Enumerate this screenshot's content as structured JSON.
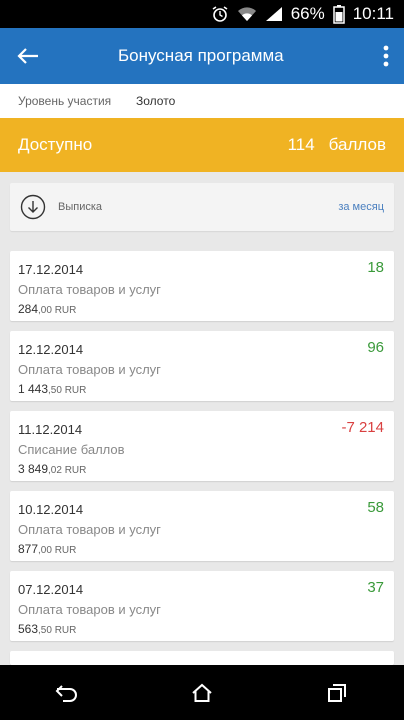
{
  "status_bar": {
    "battery": "66%",
    "time": "10:11"
  },
  "app_bar": {
    "title": "Бонусная программа"
  },
  "level": {
    "label": "Уровень участия",
    "value": "Золото"
  },
  "available": {
    "label": "Доступно",
    "amount": "114",
    "unit": "баллов"
  },
  "statement": {
    "label": "Выписка",
    "period": "за месяц"
  },
  "transactions": [
    {
      "date": "17.12.2014",
      "description": "Оплата товаров и услуг",
      "sum_main": "284",
      "sum_frac": ",00 RUR",
      "points": "18",
      "sign": "pos"
    },
    {
      "date": "12.12.2014",
      "description": "Оплата товаров и услуг",
      "sum_main": "1 443",
      "sum_frac": ",50 RUR",
      "points": "96",
      "sign": "pos"
    },
    {
      "date": "11.12.2014",
      "description": "Списание баллов",
      "sum_main": "3 849",
      "sum_frac": ",02 RUR",
      "points": "-7 214",
      "sign": "neg"
    },
    {
      "date": "10.12.2014",
      "description": "Оплата товаров и услуг",
      "sum_main": "877",
      "sum_frac": ",00 RUR",
      "points": "58",
      "sign": "pos"
    },
    {
      "date": "07.12.2014",
      "description": "Оплата товаров и услуг",
      "sum_main": "563",
      "sum_frac": ",50 RUR",
      "points": "37",
      "sign": "pos"
    }
  ],
  "colors": {
    "app_bar": "#2473bf",
    "available_bar": "#f0b323",
    "positive": "#3a9a3a",
    "negative": "#d94040"
  }
}
